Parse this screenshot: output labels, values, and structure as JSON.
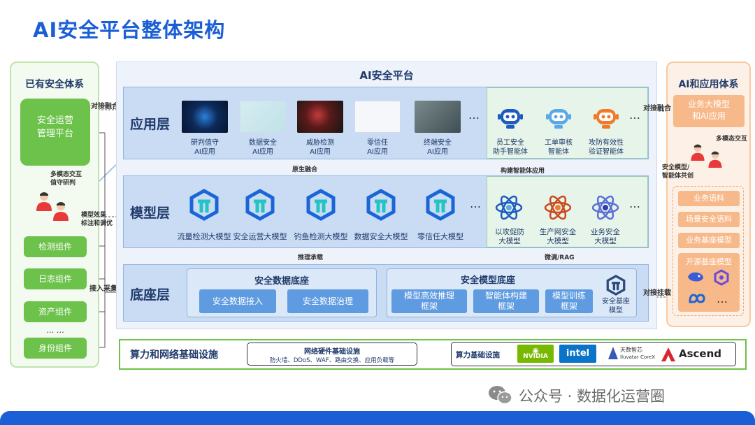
{
  "title": "AI安全平台整体架构",
  "left": {
    "title": "已有安全体系",
    "ops_platform": [
      "安全运营",
      "管理平台"
    ],
    "interaction_label": [
      "多模态交互",
      "值守研判"
    ],
    "components": [
      "检测组件",
      "日志组件",
      "资产组件",
      "… …",
      "身份组件"
    ]
  },
  "platform": {
    "title": "AI安全平台",
    "app_layer": {
      "label": "应用层",
      "apps": [
        {
          "name": [
            "研判值守",
            "AI应用"
          ]
        },
        {
          "name": [
            "数据安全",
            "AI应用"
          ]
        },
        {
          "name": [
            "威胁检测",
            "AI应用"
          ]
        },
        {
          "name": [
            "零信任",
            "AI应用"
          ]
        },
        {
          "name": [
            "终端安全",
            "AI应用"
          ]
        }
      ],
      "agents": [
        {
          "name": [
            "员工安全",
            "助手智能体"
          ]
        },
        {
          "name": [
            "工单审核",
            "智能体"
          ]
        },
        {
          "name": [
            "攻防有效性",
            "验证智能体"
          ]
        }
      ],
      "dots": "…"
    },
    "model_layer": {
      "label": "模型层",
      "models": [
        "流量检测大模型",
        "安全运营大模型",
        "钓鱼检测大模型",
        "数据安全大模型",
        "零信任大模型"
      ],
      "big_models": [
        {
          "name": [
            "以攻促防",
            "大模型"
          ]
        },
        {
          "name": [
            "生产网安全",
            "大模型"
          ]
        },
        {
          "name": [
            "业务安全",
            "大模型"
          ]
        }
      ],
      "dots": "…"
    },
    "base_layer": {
      "label": "底座层",
      "data_base": {
        "title": "安全数据底座",
        "items": [
          "安全数据接入",
          "安全数据治理"
        ]
      },
      "model_base": {
        "title": "安全模型底座",
        "items": [
          [
            "模型高效推理",
            "框架"
          ],
          [
            "智能体构建",
            "框架"
          ],
          [
            "模型训练",
            "框架"
          ]
        ],
        "base_model": [
          "安全基座",
          "模型"
        ]
      }
    },
    "labels": {
      "native_fusion": "原生融合",
      "build_agent": "构建智能体应用",
      "inference": "推理承载",
      "finetune": "微调/RAG"
    }
  },
  "connectors": {
    "dock_fusion_left": "对接融合",
    "model_effect": [
      "模型效果",
      "标注和调优"
    ],
    "access_collect": "接入采集",
    "dock_fusion_right": "对接融合",
    "dock_mount": "对接挂载",
    "multimodal": "多模态交互",
    "security_model": [
      "安全模型/",
      "智能体共创"
    ]
  },
  "right": {
    "title": "AI和应用体系",
    "business": [
      "业务大模型",
      "和AI应用"
    ],
    "items": [
      "业务语料",
      "场景安全语料",
      "业务基座模型"
    ],
    "open_source": "开源基座模型",
    "dots": "…"
  },
  "infra": {
    "label": "算力和网络基础设施",
    "network_title": "网络硬件基础设施",
    "network_items": "防火墙、DDoS、WAF、路由交换、应用负载等",
    "compute_title": "算力基础设施",
    "vendors": [
      "NVIDIA",
      "intel",
      "天数智芯",
      "Iluvatar CoreX",
      "Ascend"
    ]
  },
  "watermark": "公众号 · 数据化运营圈",
  "colors": {
    "title": "#1a5fd6",
    "green": "#6cc24a",
    "layer": "#c9dcf3",
    "orange": "#f7b98a"
  }
}
